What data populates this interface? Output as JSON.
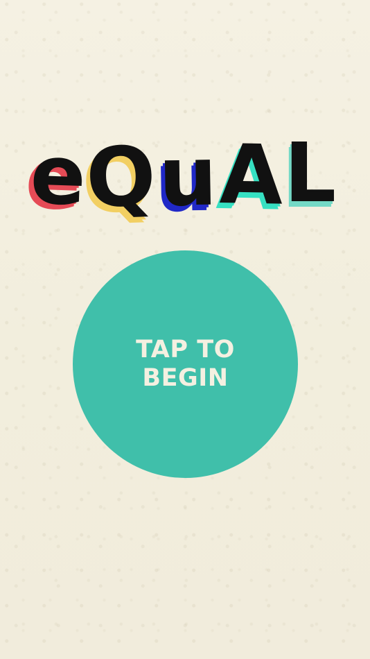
{
  "logo": {
    "letters": [
      "e",
      "Q",
      "u",
      "A",
      "L"
    ]
  },
  "start_button": {
    "label": "TAP TO BEGIN"
  },
  "colors": {
    "background": "#f4f0e1",
    "logo_black": "#111111",
    "accent_red": "#e54b56",
    "accent_yellow": "#f2cf62",
    "accent_blue": "#2028c7",
    "accent_turquoise": "#36e0c2",
    "button_teal": "#40bfaa",
    "button_text": "#f4f0e1"
  }
}
